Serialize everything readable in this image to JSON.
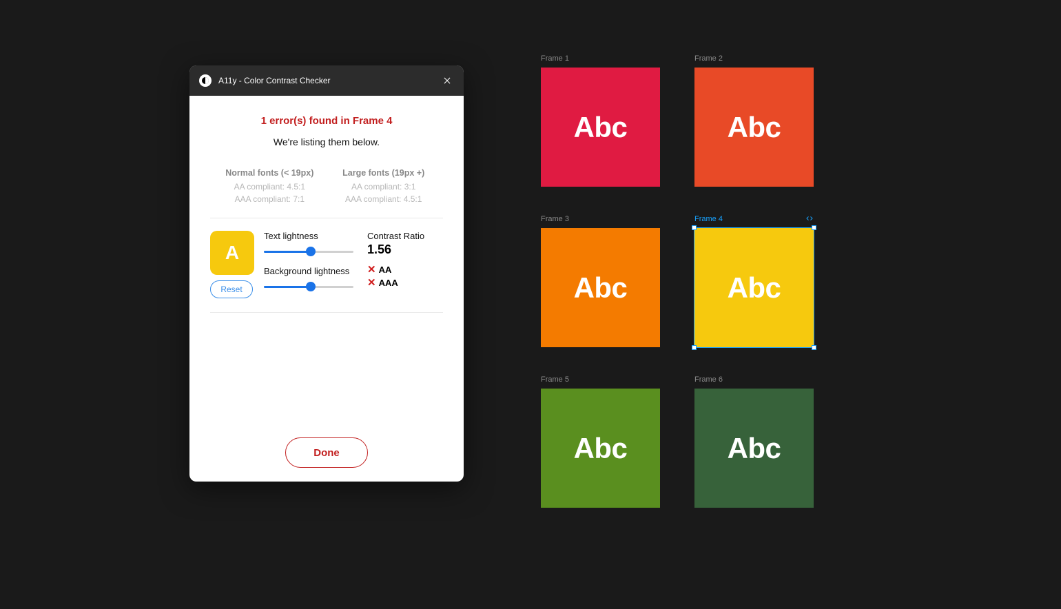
{
  "dialog": {
    "title": "A11y - Color Contrast Checker",
    "error_heading": "1 error(s) found in Frame 4",
    "sub_heading": "We're listing them below.",
    "compliance": {
      "normal": {
        "title": "Normal fonts (< 19px)",
        "aa": "AA compliant: 4.5:1",
        "aaa": "AAA compliant: 7:1"
      },
      "large": {
        "title": "Large fonts (19px +)",
        "aa": "AA compliant: 3:1",
        "aaa": "AAA compliant: 4.5:1"
      }
    },
    "swatch_letter": "A",
    "swatch_bg": "#f6c90e",
    "swatch_fg": "#ffffff",
    "text_lightness_label": "Text lightness",
    "text_lightness_value": 0.52,
    "bg_lightness_label": "Background lightness",
    "bg_lightness_value": 0.52,
    "ratio_label": "Contrast Ratio",
    "ratio_value": "1.56",
    "aa_label": "AA",
    "aaa_label": "AAA",
    "aa_pass": false,
    "aaa_pass": false,
    "reset_label": "Reset",
    "done_label": "Done"
  },
  "frames": [
    {
      "label": "Frame 1",
      "bg": "#e01b42",
      "text": "Abc",
      "selected": false
    },
    {
      "label": "Frame 2",
      "bg": "#e84a27",
      "text": "Abc",
      "selected": false
    },
    {
      "label": "Frame 3",
      "bg": "#f47b00",
      "text": "Abc",
      "selected": false
    },
    {
      "label": "Frame 4",
      "bg": "#f6c90e",
      "text": "Abc",
      "selected": true
    },
    {
      "label": "Frame 5",
      "bg": "#5a8f1f",
      "text": "Abc",
      "selected": false
    },
    {
      "label": "Frame 6",
      "bg": "#37623a",
      "text": "Abc",
      "selected": false
    }
  ]
}
